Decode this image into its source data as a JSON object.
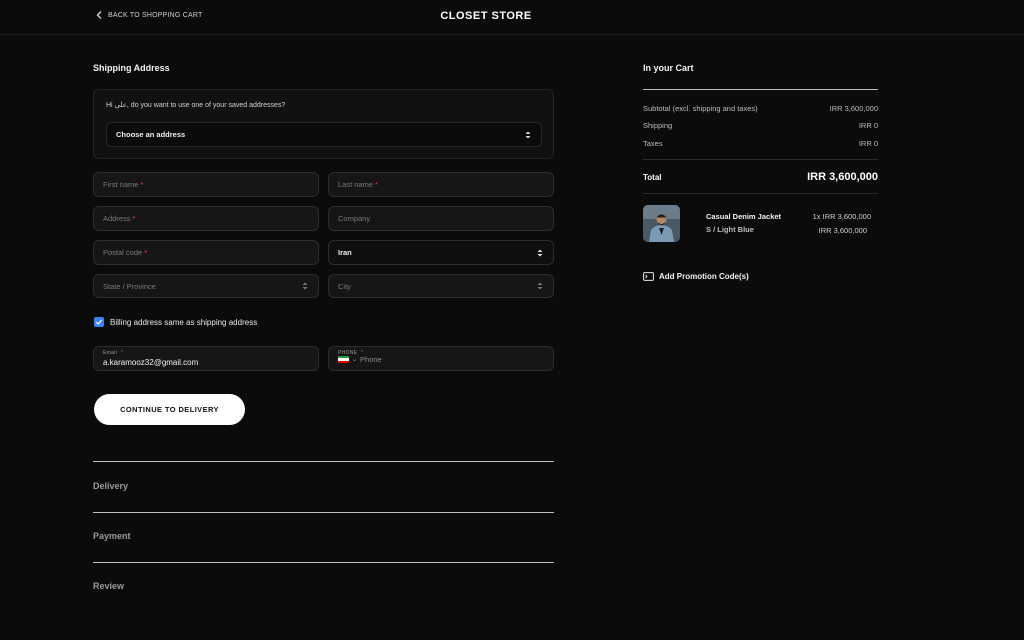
{
  "header": {
    "back_label": "BACK TO SHOPPING CART",
    "store_title": "CLOSET STORE"
  },
  "shipping": {
    "title": "Shipping Address",
    "saved_hint": "Hi علی, do you want to use one of your saved addresses?",
    "saved_select": "Choose an address",
    "first_name": "First name",
    "last_name": "Last name",
    "address": "Address",
    "company": "Company",
    "postal_code": "Postal code",
    "country": "Iran",
    "state": "State / Province",
    "city": "City",
    "required_mark": "*",
    "billing_same_label": "Billing address same as shipping address",
    "email_label": "Email",
    "email_value": "a.karamooz32@gmail.com",
    "phone_label": "PHONE",
    "phone_placeholder": "Phone",
    "phone_arrow": "⌄",
    "continue_label": "CONTINUE TO DELIVERY"
  },
  "steps": [
    "Delivery",
    "Payment",
    "Review"
  ],
  "cart": {
    "title": "In your Cart",
    "subtotal_label": "Subtotal (excl. shipping and taxes)",
    "subtotal_value": "IRR 3,600,000",
    "shipping_label": "Shipping",
    "shipping_value": "IRR 0",
    "taxes_label": "Taxes",
    "taxes_value": "IRR 0",
    "total_label": "Total",
    "total_value": "IRR 3,600,000",
    "item": {
      "name": "Casual Denim Jacket",
      "variant": "S / Light Blue",
      "qty_price": "1x IRR 3,600,000",
      "line_total": "IRR 3,600,000"
    },
    "promo_label": "Add Promotion Code(s)"
  },
  "colors": {
    "background": "#0b0b0b",
    "accent_checkbox": "#3b82f6",
    "required": "#e0464e",
    "button": "#ffffff"
  }
}
